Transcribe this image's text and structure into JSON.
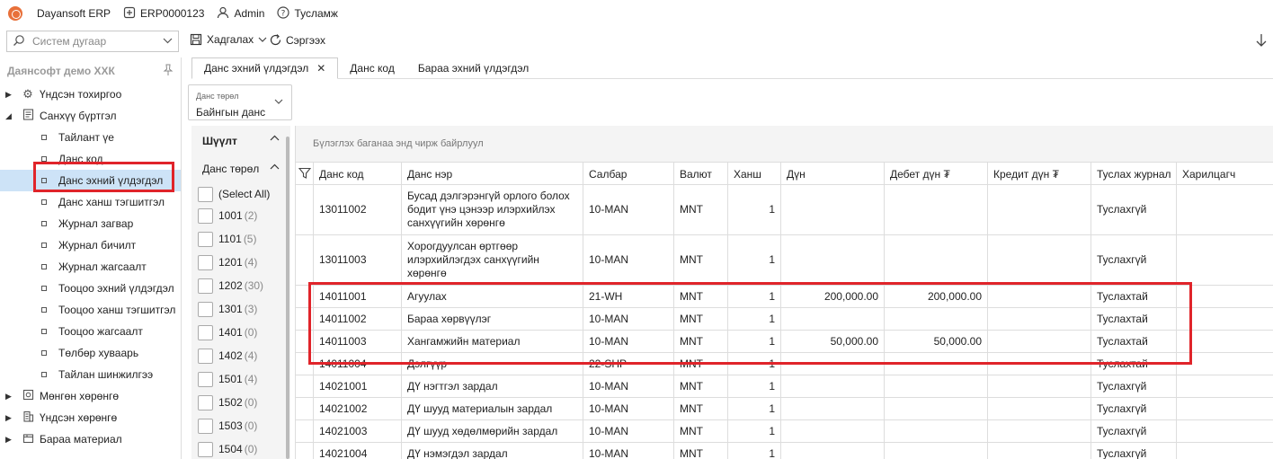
{
  "topbar": {
    "app_name": "Dayansoft ERP",
    "company_code": "ERP0000123",
    "user": "Admin",
    "help": "Тусламж"
  },
  "toolbar": {
    "search_placeholder": "Систем дугаар",
    "save_label": "Хадгалах",
    "refresh_label": "Сэргээх"
  },
  "sidebar": {
    "title": "Даянсофт демо ХХК",
    "items": [
      {
        "label": "Үндсэн тохиргоо",
        "icon": "gear-icon",
        "level": 0,
        "expanded": false
      },
      {
        "label": "Санхүү бүртгэл",
        "icon": "ledger-icon",
        "level": 0,
        "expanded": true
      },
      {
        "label": "Тайлант үе",
        "level": 1
      },
      {
        "label": "Данс код",
        "level": 1
      },
      {
        "label": "Данс эхний үлдэгдэл",
        "level": 1,
        "selected": true
      },
      {
        "label": "Данс ханш тэгшитгэл",
        "level": 1
      },
      {
        "label": "Журнал загвар",
        "level": 1
      },
      {
        "label": "Журнал бичилт",
        "level": 1
      },
      {
        "label": "Журнал жагсаалт",
        "level": 1
      },
      {
        "label": "Тооцоо эхний үлдэгдэл",
        "level": 1
      },
      {
        "label": "Тооцоо ханш тэгшитгэл",
        "level": 1
      },
      {
        "label": "Тооцоо жагсаалт",
        "level": 1
      },
      {
        "label": "Төлбөр хуваарь",
        "level": 1
      },
      {
        "label": "Тайлан шинжилгээ",
        "level": 1
      },
      {
        "label": "Мөнгөн хөрөнгө",
        "icon": "cash-icon",
        "level": 0,
        "expanded": false
      },
      {
        "label": "Үндсэн хөрөнгө",
        "icon": "building-icon",
        "level": 0,
        "expanded": false
      },
      {
        "label": "Бараа материал",
        "icon": "box-icon",
        "level": 0,
        "expanded": false
      }
    ]
  },
  "tabs": [
    {
      "label": "Данс эхний үлдэгдэл",
      "active": true
    },
    {
      "label": "Данс код",
      "active": false
    },
    {
      "label": "Бараа эхний үлдэгдэл",
      "active": false
    }
  ],
  "account_type": {
    "label": "Данс төрөл",
    "value": "Байнгын данс"
  },
  "filter": {
    "title": "Шүүлт",
    "group": "Данс төрөл",
    "options": [
      {
        "label": "(Select All)",
        "count": ""
      },
      {
        "label": "1001",
        "count": "(2)"
      },
      {
        "label": "1101",
        "count": "(5)"
      },
      {
        "label": "1201",
        "count": "(4)"
      },
      {
        "label": "1202",
        "count": "(30)"
      },
      {
        "label": "1301",
        "count": "(3)"
      },
      {
        "label": "1401",
        "count": "(0)"
      },
      {
        "label": "1402",
        "count": "(4)"
      },
      {
        "label": "1501",
        "count": "(4)"
      },
      {
        "label": "1502",
        "count": "(0)"
      },
      {
        "label": "1503",
        "count": "(0)"
      },
      {
        "label": "1504",
        "count": "(0)"
      }
    ]
  },
  "grid": {
    "group_hint": "Бүлэглэх баганаа энд чирж байрлуул",
    "columns": [
      "Данс код",
      "Данс нэр",
      "Салбар",
      "Валют",
      "Ханш",
      "Дүн",
      "Дебет дүн ₮",
      "Кредит дүн ₮",
      "Туслах журнал",
      "Харилцагч"
    ],
    "rows": [
      {
        "code": "13011002",
        "name": "Бусад дэлгэрэнгүй орлого болох бодит үнэ цэнээр илэрхийлэх санхүүгийн хөрөнгө",
        "branch": "10-MAN",
        "currency": "MNT",
        "rate": "1",
        "amount": "",
        "debit": "",
        "credit": "",
        "sub": "Туслахгүй",
        "partner": ""
      },
      {
        "code": "13011003",
        "name": "Хорогдуулсан өртгөөр илэрхийлэгдэх санхүүгийн хөрөнгө",
        "branch": "10-MAN",
        "currency": "MNT",
        "rate": "1",
        "amount": "",
        "debit": "",
        "credit": "",
        "sub": "Туслахгүй",
        "partner": ""
      },
      {
        "code": "14011001",
        "name": "Агуулах",
        "branch": "21-WH",
        "currency": "MNT",
        "rate": "1",
        "amount": "200,000.00",
        "debit": "200,000.00",
        "credit": "",
        "sub": "Туслахтай",
        "partner": ""
      },
      {
        "code": "14011002",
        "name": "Бараа хөрвүүлэг",
        "branch": "10-MAN",
        "currency": "MNT",
        "rate": "1",
        "amount": "",
        "debit": "",
        "credit": "",
        "sub": "Туслахтай",
        "partner": ""
      },
      {
        "code": "14011003",
        "name": "Хангамжийн материал",
        "branch": "10-MAN",
        "currency": "MNT",
        "rate": "1",
        "amount": "50,000.00",
        "debit": "50,000.00",
        "credit": "",
        "sub": "Туслахтай",
        "partner": ""
      },
      {
        "code": "14011004",
        "name": "Дэлгүүр",
        "branch": "22-SHP",
        "currency": "MNT",
        "rate": "1",
        "amount": "",
        "debit": "",
        "credit": "",
        "sub": "Туслахтай",
        "partner": ""
      },
      {
        "code": "14021001",
        "name": "ДҮ нэгтгэл зардал",
        "branch": "10-MAN",
        "currency": "MNT",
        "rate": "1",
        "amount": "",
        "debit": "",
        "credit": "",
        "sub": "Туслахгүй",
        "partner": ""
      },
      {
        "code": "14021002",
        "name": "ДҮ шууд материалын зардал",
        "branch": "10-MAN",
        "currency": "MNT",
        "rate": "1",
        "amount": "",
        "debit": "",
        "credit": "",
        "sub": "Туслахгүй",
        "partner": ""
      },
      {
        "code": "14021003",
        "name": "ДҮ шууд хөдөлмөрийн зардал",
        "branch": "10-MAN",
        "currency": "MNT",
        "rate": "1",
        "amount": "",
        "debit": "",
        "credit": "",
        "sub": "Туслахгүй",
        "partner": ""
      },
      {
        "code": "14021004",
        "name": "ДҮ нэмэгдэл зардал",
        "branch": "10-MAN",
        "currency": "MNT",
        "rate": "1",
        "amount": "",
        "debit": "",
        "credit": "",
        "sub": "Туслахгүй",
        "partner": ""
      }
    ]
  },
  "colors": {
    "highlight": "#e0242a",
    "selected_bg": "#cde3f7",
    "panel_bg": "#f4f4f4"
  }
}
